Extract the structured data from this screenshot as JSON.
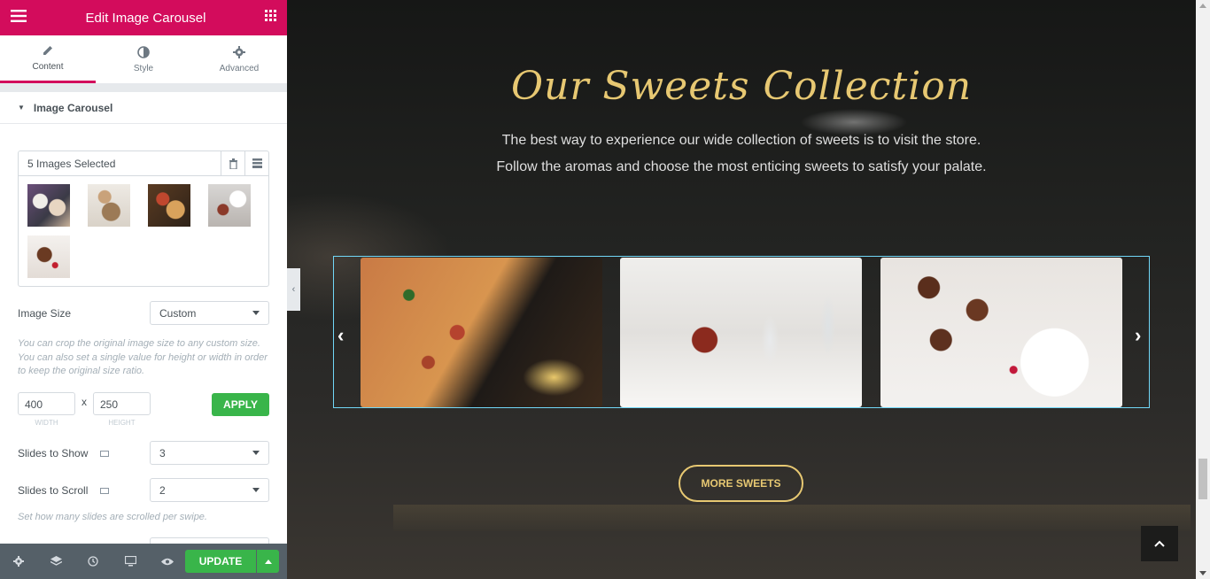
{
  "panel": {
    "title": "Edit Image Carousel",
    "tabs": [
      {
        "label": "Content",
        "icon": "pencil-icon",
        "active": true
      },
      {
        "label": "Style",
        "icon": "half-circle-icon",
        "active": false
      },
      {
        "label": "Advanced",
        "icon": "gear-icon",
        "active": false
      }
    ],
    "section_title": "Image Carousel",
    "gallery": {
      "label": "5 Images Selected",
      "thumbnails": [
        "waffles-plate",
        "latte-and-cake",
        "pizza-tray",
        "cupcake-table",
        "brownie-slice"
      ]
    },
    "image_size": {
      "label": "Image Size",
      "value": "Custom"
    },
    "crop_note": "You can crop the original image size to any custom size. You can also set a single value for height or width in order to keep the original size ratio.",
    "width": {
      "value": "400",
      "label": "WIDTH"
    },
    "separator": "x",
    "height": {
      "value": "250",
      "label": "HEIGHT"
    },
    "apply_label": "APPLY",
    "slides_to_show": {
      "label": "Slides to Show",
      "value": "3"
    },
    "slides_to_scroll": {
      "label": "Slides to Scroll",
      "value": "2"
    },
    "scroll_note": "Set how many slides are scrolled per swipe.",
    "footer": {
      "update_label": "UPDATE"
    }
  },
  "preview": {
    "heading": "Our Sweets Collection",
    "sub_line1": "The best way to experience our wide collection of sweets is to visit the store.",
    "sub_line2": "Follow the aromas and choose the most enticing sweets to satisfy your palate.",
    "slides": [
      "pizza-slide",
      "cupcake-slide",
      "brownie-slide"
    ],
    "button_label": "MORE SWEETS"
  },
  "colors": {
    "brand": "#d30c5c",
    "accent_gold": "#e7c872",
    "update_green": "#39b54a",
    "selection_border": "#71d7f7"
  }
}
